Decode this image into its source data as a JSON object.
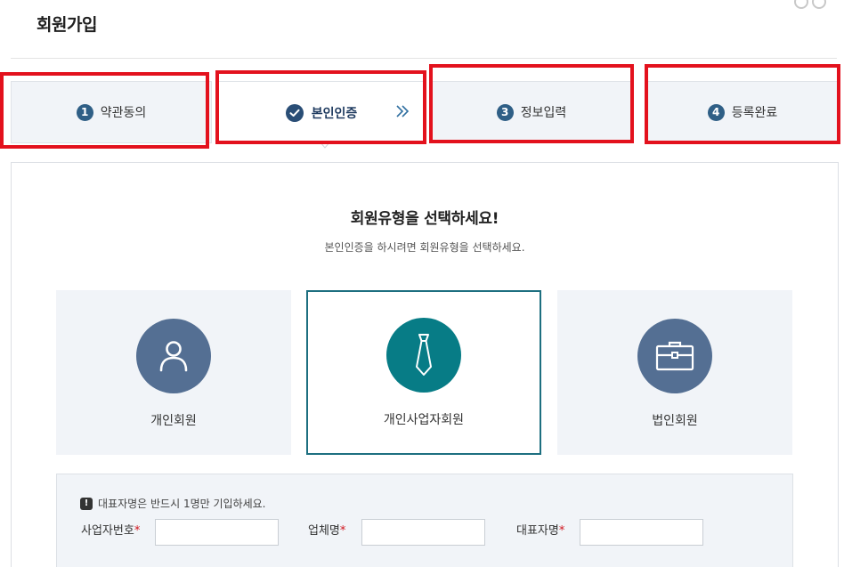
{
  "page": {
    "title": "회원가입"
  },
  "steps": [
    {
      "num": "1",
      "label": "약관동의",
      "active": false
    },
    {
      "num": "",
      "label": "본인인증",
      "active": true
    },
    {
      "num": "3",
      "label": "정보입력",
      "active": false
    },
    {
      "num": "4",
      "label": "등록완료",
      "active": false
    }
  ],
  "section": {
    "heading": "회원유형을 선택하세요!",
    "subheading": "본인인증을 하시려면 회원유형을 선택하세요."
  },
  "member_types": [
    {
      "label": "개인회원",
      "icon": "person-icon",
      "selected": false
    },
    {
      "label": "개인사업자회원",
      "icon": "necktie-icon",
      "selected": true
    },
    {
      "label": "법인회원",
      "icon": "briefcase-icon",
      "selected": false
    }
  ],
  "form": {
    "notice": "대표자명은 반드시 1명만 기입하세요.",
    "fields": [
      {
        "label": "사업자번호",
        "required_mark": "*",
        "value": ""
      },
      {
        "label": "업체명",
        "required_mark": "*",
        "value": ""
      },
      {
        "label": "대표자명",
        "required_mark": "*",
        "value": ""
      }
    ]
  },
  "colors": {
    "primary_dark": "#2f5f86",
    "teal_selected": "#077c86",
    "card_icon": "#546f93",
    "highlight_red": "#e3111d",
    "required": "#d0121b"
  }
}
